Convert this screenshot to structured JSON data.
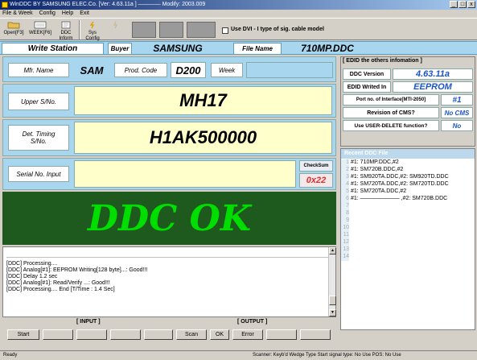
{
  "window": {
    "title": "WinDDC BY SAMSUNG ELEC.Co. [Ver: 4.63.11a ] ———— Modify: 2003.009",
    "min_glyph": "_",
    "max_glyph": "□",
    "close_glyph": "x"
  },
  "menu": [
    "File & Week",
    "Config",
    "Help",
    "Exit"
  ],
  "toolbar": {
    "buttons": [
      {
        "label_line1": "Open[F3]",
        "label_line2": "",
        "icon": "folder-icon"
      },
      {
        "label_line1": "WEEK[F6]",
        "label_line2": "",
        "icon": "calendar-icon"
      },
      {
        "label_line1": "DDC",
        "label_line2": "Inform",
        "icon": "info-icon"
      },
      {
        "label_line1": "Sys",
        "label_line2": "Config",
        "icon": "config-icon"
      },
      {
        "label_line1": "",
        "label_line2": "",
        "icon": "disabled-icon"
      }
    ],
    "dvi_label": "Use DVI - I type of sig. cable model"
  },
  "station": {
    "write_station_label": "Write Station",
    "buyer_label": "Buyer",
    "buyer_value": "SAMSUNG",
    "file_name_label": "File Name",
    "file_name_value": "710MP.DDC"
  },
  "form": {
    "mfr_name_label": "Mfr. Name",
    "mfr_name_value": "SAM",
    "prod_code_label": "Prod. Code",
    "prod_code_value": "D200",
    "week_label": "Week",
    "week_value": "",
    "upper_sno_label": "Upper S/No.",
    "upper_sno_value": "MH17",
    "det_timing_label_1": "Det. Timing",
    "det_timing_label_2": "S/No.",
    "det_timing_value": "H1AK500000",
    "serial_input_label": "Serial No. Input",
    "serial_input_value": "",
    "checksum_label": "CheckSum",
    "checksum_value": "0x22"
  },
  "status_banner": "DDC OK",
  "log": [
    "[DDC] Processing....",
    "[DDC] Analog[#1]: EEPROM Writing[128 byte]...: Good!!!",
    "[DDC] Delay 1.2 sec",
    "[DDC] Analog[#1]: Read/Verify ...: Good!!!",
    "[DDC] Processing.... End [T/Time : 1.4 Sec]"
  ],
  "io": {
    "input_label": "[ INPUT ]",
    "output_label": "[ OUTPUT ]",
    "start": "Start",
    "scan": "Scan",
    "ok": "OK",
    "error": "Error"
  },
  "edid": {
    "title": "[ EDID the others infomation ]",
    "ddc_version_label": "DDC Version",
    "ddc_version_value": "4.63.11a",
    "edid_written_label": "EDID Writed In",
    "edid_written_value": "EEPROM",
    "port_label": "Port no. of Interface[MTI-2050]",
    "port_value": "#1",
    "cms_label": "Revision of CMS?",
    "cms_value": "No CMS",
    "user_delete_label": "Use USER-DELETE function?",
    "user_delete_value": "No"
  },
  "recent": {
    "title": "Recent DDC File",
    "rows": [
      {
        "num": "1",
        "text": "#1: 710MP.DDC,#2"
      },
      {
        "num": "2",
        "text": "#1: SM720B.DDC,#2"
      },
      {
        "num": "3",
        "text": "#1: SM920TA.DDC,#2: SM920TD.DDC"
      },
      {
        "num": "4",
        "text": "#1: SM720TA.DDC,#2: SM720TD.DDC"
      },
      {
        "num": "5",
        "text": "#1: SM720TA.DDC,#2"
      },
      {
        "num": "6",
        "text": "#1: ——————— ,#2: SM720B.DDC"
      },
      {
        "num": "7",
        "text": ""
      },
      {
        "num": "8",
        "text": ""
      },
      {
        "num": "9",
        "text": ""
      },
      {
        "num": "10",
        "text": ""
      },
      {
        "num": "11",
        "text": ""
      },
      {
        "num": "12",
        "text": ""
      },
      {
        "num": "13",
        "text": ""
      },
      {
        "num": "14",
        "text": ""
      }
    ]
  },
  "statusbar": {
    "left": "Ready",
    "right": "Scanner: Keyb'd Wedge Type  Start signal type: No Use  POS: No Use"
  },
  "colors": {
    "panel_blue": "#a7d6ee",
    "value_yellow": "#ffffcc",
    "banner_bg": "#1e5a1e",
    "banner_text": "#00dd00",
    "checksum_red": "#e03030",
    "edid_value_blue": "#1a55c8"
  }
}
